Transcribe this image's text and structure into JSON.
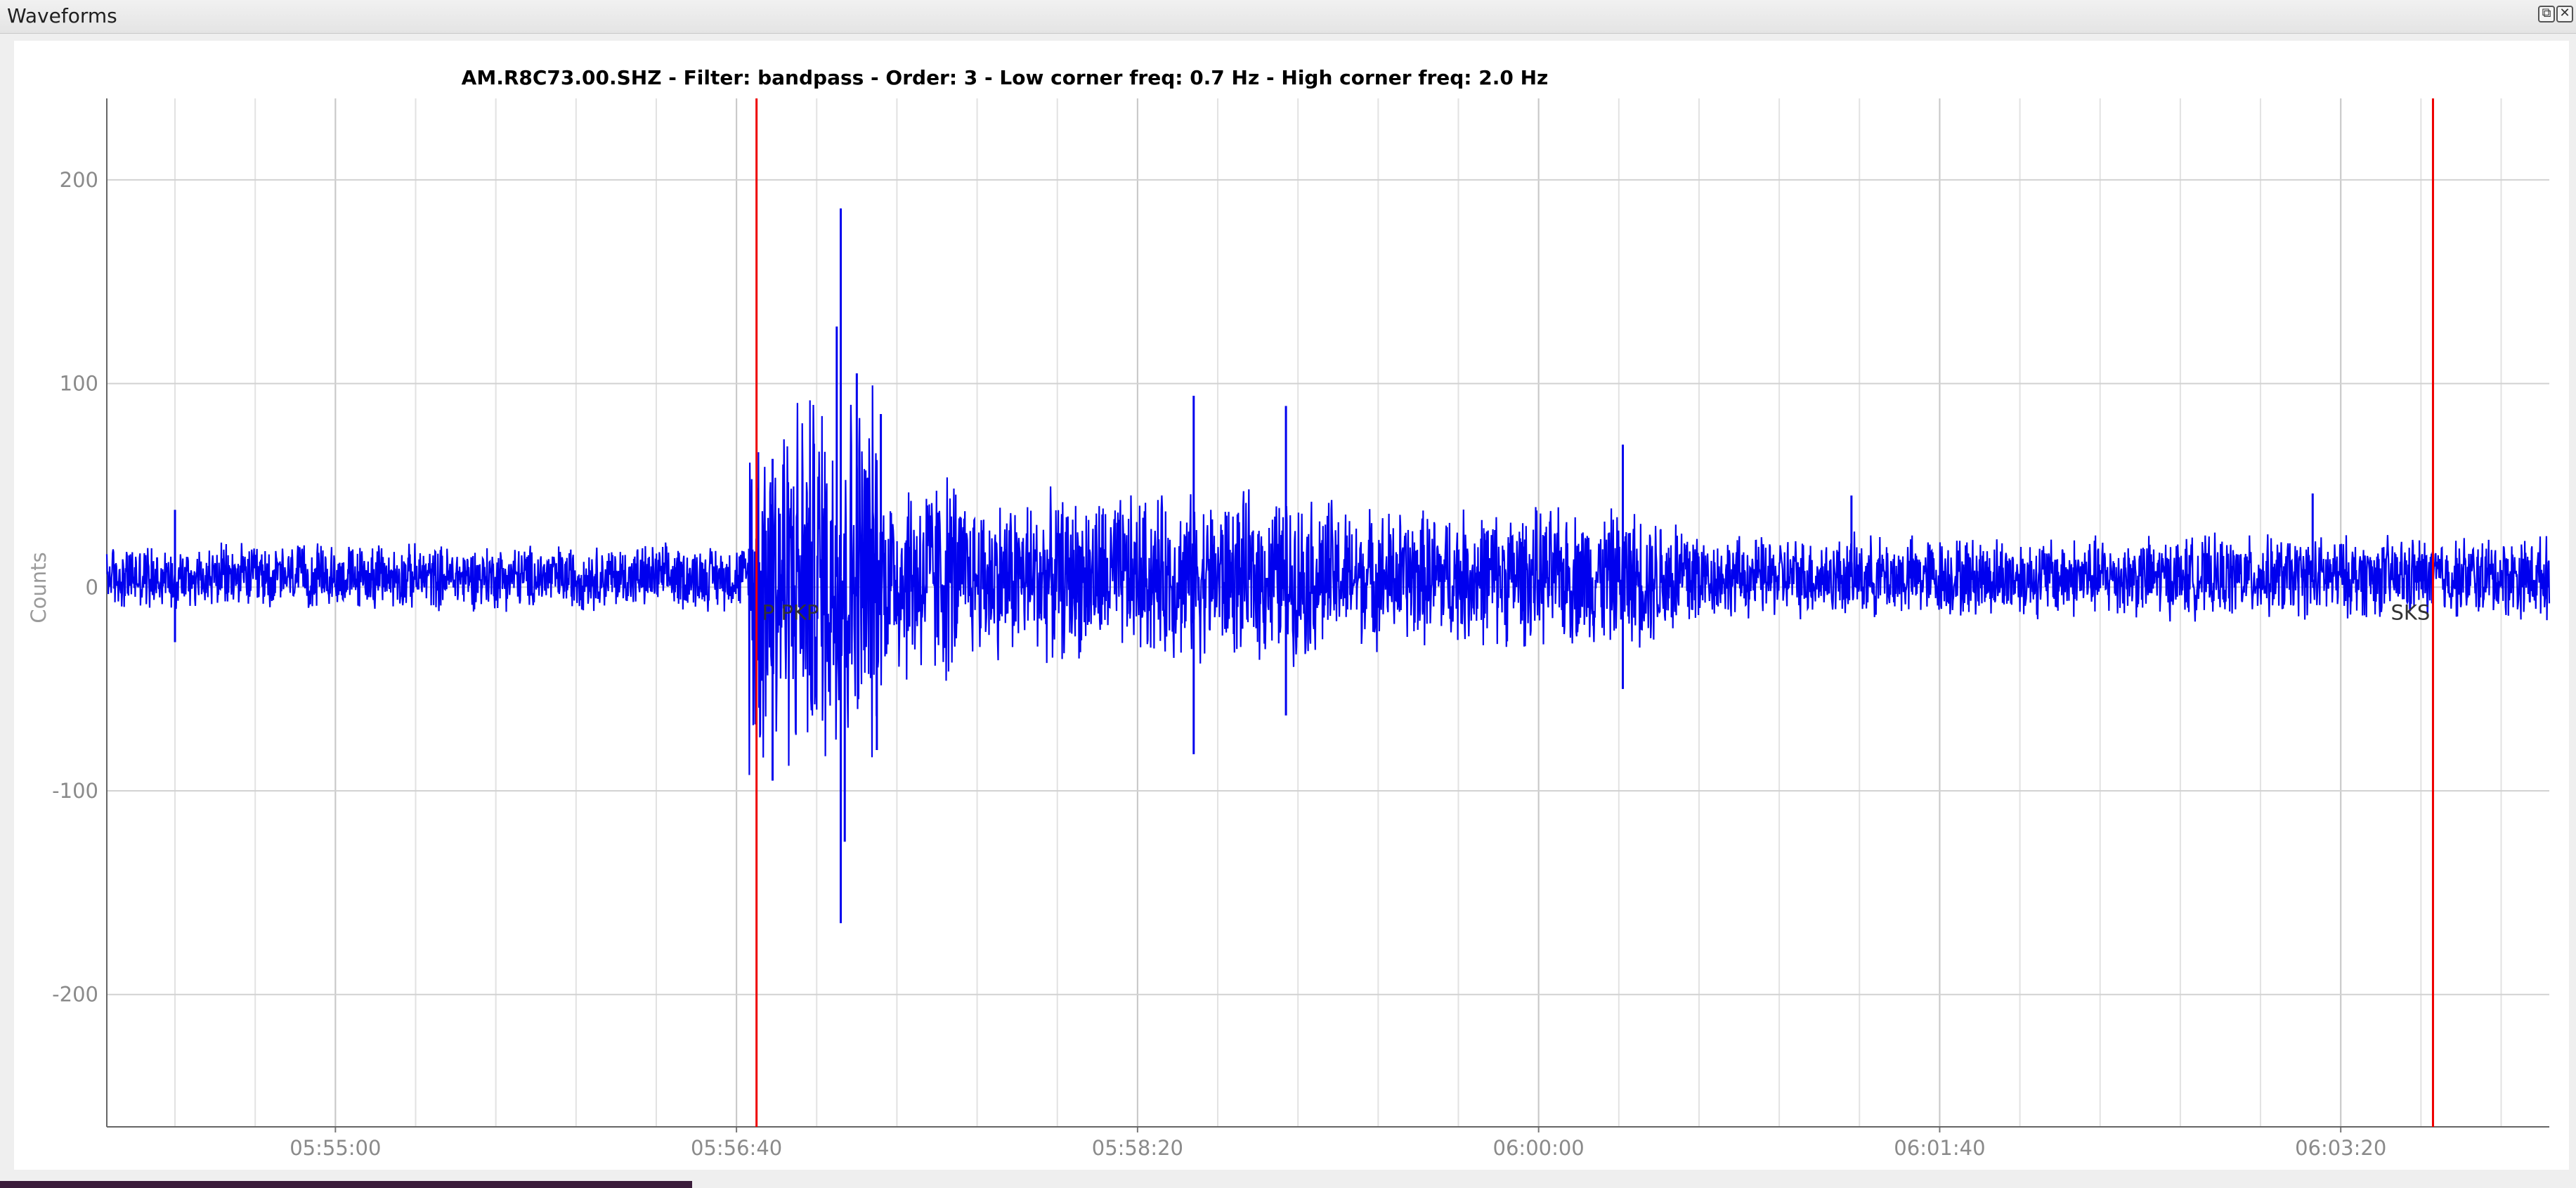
{
  "window": {
    "title": "Waveforms",
    "float_icon": "float-window-icon",
    "close_icon": "close-icon"
  },
  "chart_data": {
    "type": "line",
    "title": "AM.R8C73.00.SHZ - Filter: bandpass - Order: 3 - Low corner freq: 0.7 Hz - High corner freq: 2.0 Hz",
    "xlabel": "",
    "ylabel": "Counts",
    "x_range": [
      "05:54:03",
      "06:04:12"
    ],
    "ylim": [
      -265,
      240
    ],
    "x_ticks": [
      "05:55:00",
      "05:56:40",
      "05:58:20",
      "06:00:00",
      "06:01:40",
      "06:03:20"
    ],
    "y_ticks": [
      200,
      100,
      0,
      -100,
      -200
    ],
    "grid": true,
    "line_color": "#0000ee",
    "marker_color": "#ee0000",
    "series": [
      {
        "baseline": 5,
        "noise_amplitude": 12,
        "envelope": [
          {
            "start": "05:54:03",
            "end": "05:56:43",
            "amplitude": 12
          },
          {
            "start": "05:56:43",
            "end": "05:57:15",
            "amplitude": 70
          },
          {
            "start": "05:57:15",
            "end": "05:57:35",
            "amplitude": 40
          },
          {
            "start": "05:57:35",
            "end": "05:59:10",
            "amplitude": 30
          },
          {
            "start": "05:59:10",
            "end": "06:00:40",
            "amplitude": 25
          },
          {
            "start": "06:00:40",
            "end": "06:04:12",
            "amplitude": 15
          }
        ],
        "peaks": [
          {
            "x": "05:54:20",
            "y": 38
          },
          {
            "x": "05:54:20",
            "y": -27
          },
          {
            "x": "05:56:49",
            "y": 63
          },
          {
            "x": "05:56:49",
            "y": -95
          },
          {
            "x": "05:57:05",
            "y": 128
          },
          {
            "x": "05:57:06",
            "y": 186
          },
          {
            "x": "05:57:06",
            "y": -165
          },
          {
            "x": "05:57:07",
            "y": -125
          },
          {
            "x": "05:57:10",
            "y": 105
          },
          {
            "x": "05:57:15",
            "y": -80
          },
          {
            "x": "05:57:16",
            "y": 85
          },
          {
            "x": "05:58:34",
            "y": 94
          },
          {
            "x": "05:58:34",
            "y": -82
          },
          {
            "x": "05:58:57",
            "y": 89
          },
          {
            "x": "05:58:57",
            "y": -63
          },
          {
            "x": "06:00:21",
            "y": 70
          },
          {
            "x": "06:00:21",
            "y": -50
          },
          {
            "x": "06:01:18",
            "y": 45
          },
          {
            "x": "06:03:13",
            "y": 46
          }
        ]
      }
    ],
    "phase_markers": [
      {
        "label": "P PKP",
        "time": "05:56:45"
      },
      {
        "label": "SKS",
        "time": "06:03:43"
      }
    ]
  }
}
